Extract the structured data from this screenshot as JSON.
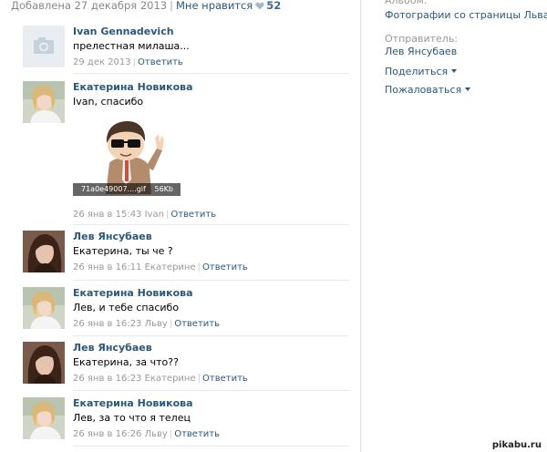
{
  "post_header": {
    "added_text": "Добавлена 27 декабря 2013",
    "separator": "|",
    "like_label": "Мне нравится",
    "like_count": "52"
  },
  "sidebar": {
    "album_label": "Альбом:",
    "album_link": "Фотографии со страницы Льва",
    "sender_label": "Отправитель:",
    "sender_link": "Лев Янсубаев",
    "share_label": "Поделиться",
    "report_label": "Пожаловаться"
  },
  "comments": [
    {
      "author": "Ivan Gennadevich",
      "text": "прелестная милаша...",
      "date": "29 дек 2013",
      "reply_to": "",
      "reply_label": "Ответить",
      "avatar": "camera-placeholder"
    },
    {
      "author": "Екатерина Новикова",
      "text": "Ivan, спасибо",
      "date": "26 янв в 15:43",
      "reply_to": "Ivan",
      "reply_label": "Ответить",
      "avatar": "blonde-girl",
      "attachment": {
        "filename": "71a0e49007....gif",
        "size": "56Kb"
      }
    },
    {
      "author": "Лев Янсубаев",
      "text": "Екатерина, ты че ?",
      "date": "26 янв в 16:11",
      "reply_to": "Екатерине",
      "reply_label": "Ответить",
      "avatar": "dark-hair-girl"
    },
    {
      "author": "Екатерина Новикова",
      "text": "Лев, и тебе спасибо",
      "date": "26 янв в 16:23",
      "reply_to": "Льву",
      "reply_label": "Ответить",
      "avatar": "blonde-girl"
    },
    {
      "author": "Лев Янсубаев",
      "text": "Екатерина, за что??",
      "date": "26 янв в 16:23",
      "reply_to": "Екатерине",
      "reply_label": "Ответить",
      "avatar": "dark-hair-girl"
    },
    {
      "author": "Екатерина Новикова",
      "text": "Лев, за то что я телец",
      "date": "26 янв в 16:26",
      "reply_to": "Льву",
      "reply_label": "Ответить",
      "avatar": "blonde-girl"
    }
  ],
  "watermark": "pikabu.ru",
  "colors": {
    "link": "#2b587a",
    "meta": "#999999",
    "divider": "#e7eaed"
  }
}
